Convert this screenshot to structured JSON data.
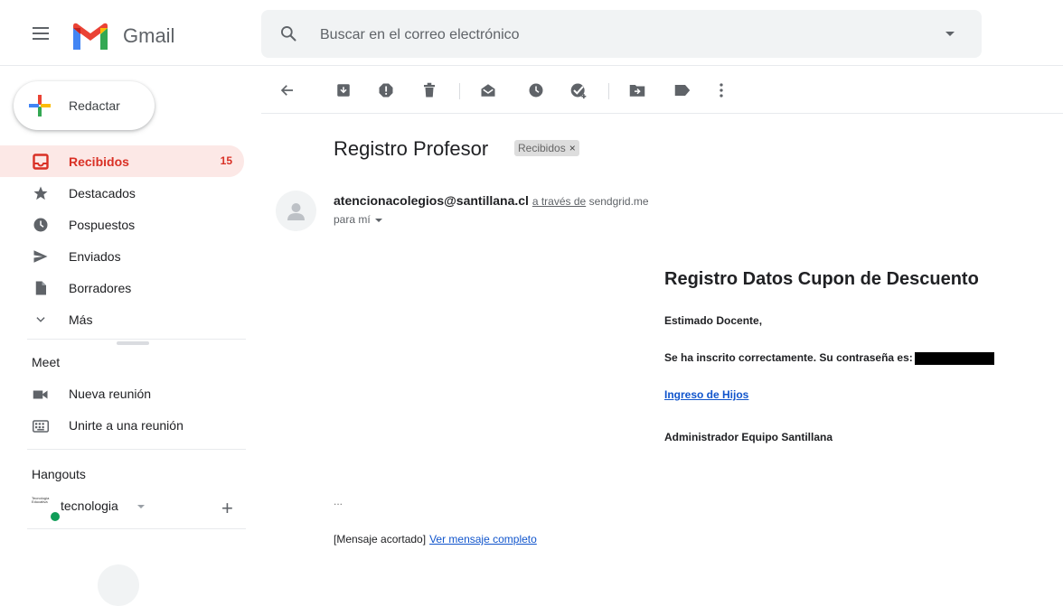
{
  "app": {
    "name": "Gmail"
  },
  "search": {
    "placeholder": "Buscar en el correo electrónico"
  },
  "compose": {
    "label": "Redactar"
  },
  "nav": {
    "items": [
      {
        "label": "Recibidos",
        "count": "15",
        "icon": "inbox-icon"
      },
      {
        "label": "Destacados",
        "icon": "star-icon"
      },
      {
        "label": "Pospuestos",
        "icon": "clock-icon"
      },
      {
        "label": "Enviados",
        "icon": "send-icon"
      },
      {
        "label": "Borradores",
        "icon": "draft-icon"
      },
      {
        "label": "Más",
        "icon": "chevron-down-icon"
      }
    ]
  },
  "meet": {
    "title": "Meet",
    "new_meeting": "Nueva reunión",
    "join_meeting": "Unirte a una reunión"
  },
  "hangouts": {
    "title": "Hangouts",
    "user": "tecnologia",
    "avatar_text": "Tecnología Educativa"
  },
  "email": {
    "subject": "Registro Profesor",
    "label": "Recibidos",
    "sender_email": "atencionacolegios@santillana.cl",
    "via_text": "a través de",
    "via_domain": "sendgrid.me",
    "to_me": "para mí",
    "body": {
      "title": "Registro Datos Cupon de Descuento",
      "greeting": "Estimado Docente,",
      "password_line": "Se ha inscrito correctamente. Su contraseña es:",
      "link": "Ingreso de Hijos",
      "signature": "Administrador Equipo Santillana"
    },
    "ellipsis": "...",
    "clipped_text": "[Mensaje acortado]",
    "view_full": "Ver mensaje completo"
  },
  "colors": {
    "active_bg": "#fce8e6",
    "active_text": "#d93025",
    "link": "#1155cc",
    "icon": "#5f6368"
  }
}
